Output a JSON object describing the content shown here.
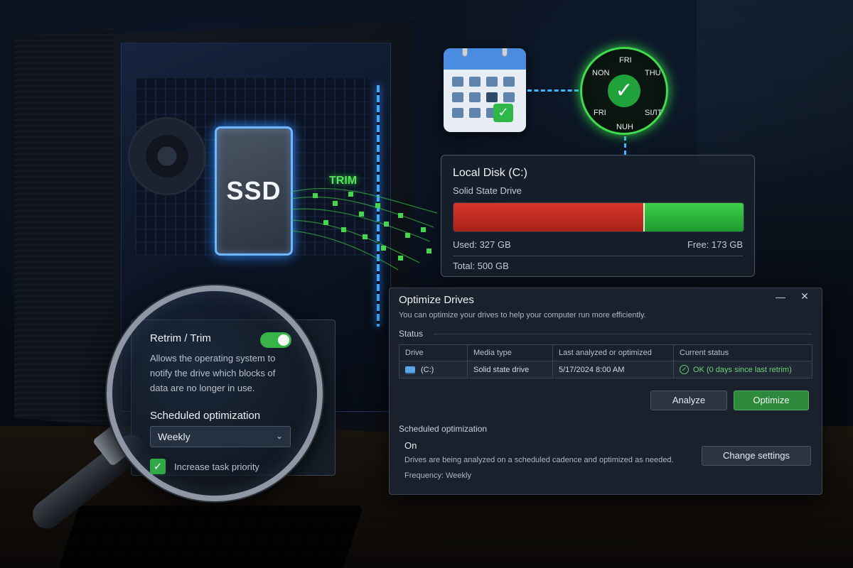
{
  "hero": {
    "ssd_label": "SSD",
    "trim_label": "TRIM"
  },
  "schedule_dial": {
    "days": [
      "FRI",
      "THU",
      "SIЛT",
      "NUH",
      "FRI",
      "NON"
    ],
    "check_icon": "check-icon"
  },
  "disk_card": {
    "title": "Local Disk (C:)",
    "subtitle": "Solid State Drive",
    "used_label": "Used: 327 GB",
    "free_label": "Free: 173 GB",
    "total_label": "Total: 500 GB",
    "used_fraction": 0.654,
    "colors": {
      "used": "#d9352b",
      "free": "#3dcf4a"
    }
  },
  "optimize_window": {
    "title": "Optimize Drives",
    "minimize_glyph": "—",
    "close_glyph": "✕",
    "description": "You can optimize your drives to help your computer run more efficiently.",
    "status_heading": "Status",
    "table": {
      "headers": [
        "Drive",
        "Media type",
        "Last analyzed or optimized",
        "Current status"
      ],
      "rows": [
        {
          "drive": "(C:)",
          "media_type": "Solid state drive",
          "last_optimized": "5/17/2024 8:00 AM",
          "status": "OK (0 days since last retrim)"
        }
      ]
    },
    "analyze_label": "Analyze",
    "optimize_label": "Optimize",
    "scheduled_heading": "Scheduled optimization",
    "scheduled_state": "On",
    "scheduled_description": "Drives are being analyzed on a scheduled cadence and optimized as needed.",
    "frequency": "Frequency: Weekly",
    "change_settings_label": "Change settings",
    "accent_color": "#2d8a3c"
  },
  "magnified_settings": {
    "title": "Retrim / Trim",
    "toggle_on": true,
    "description": "Allows the operating system to notify the drive which blocks of data are no longer in use.",
    "scheduled_heading": "Scheduled optimization",
    "frequency_value": "Weekly",
    "checkbox_label": "Increase task priority",
    "checkbox_checked": true
  }
}
